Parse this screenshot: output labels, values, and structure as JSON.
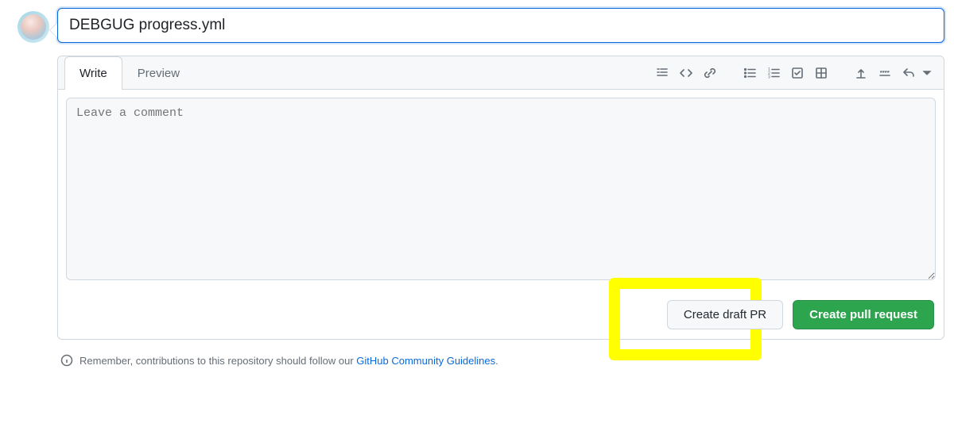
{
  "title_value": "DEBGUG progress.yml",
  "tabs": {
    "write": "Write",
    "preview": "Preview"
  },
  "comment_placeholder": "Leave a comment",
  "buttons": {
    "draft": "Create draft PR",
    "primary": "Create pull request"
  },
  "footer": {
    "prefix": "Remember, contributions to this repository should follow our ",
    "link": "GitHub Community Guidelines",
    "suffix": "."
  }
}
